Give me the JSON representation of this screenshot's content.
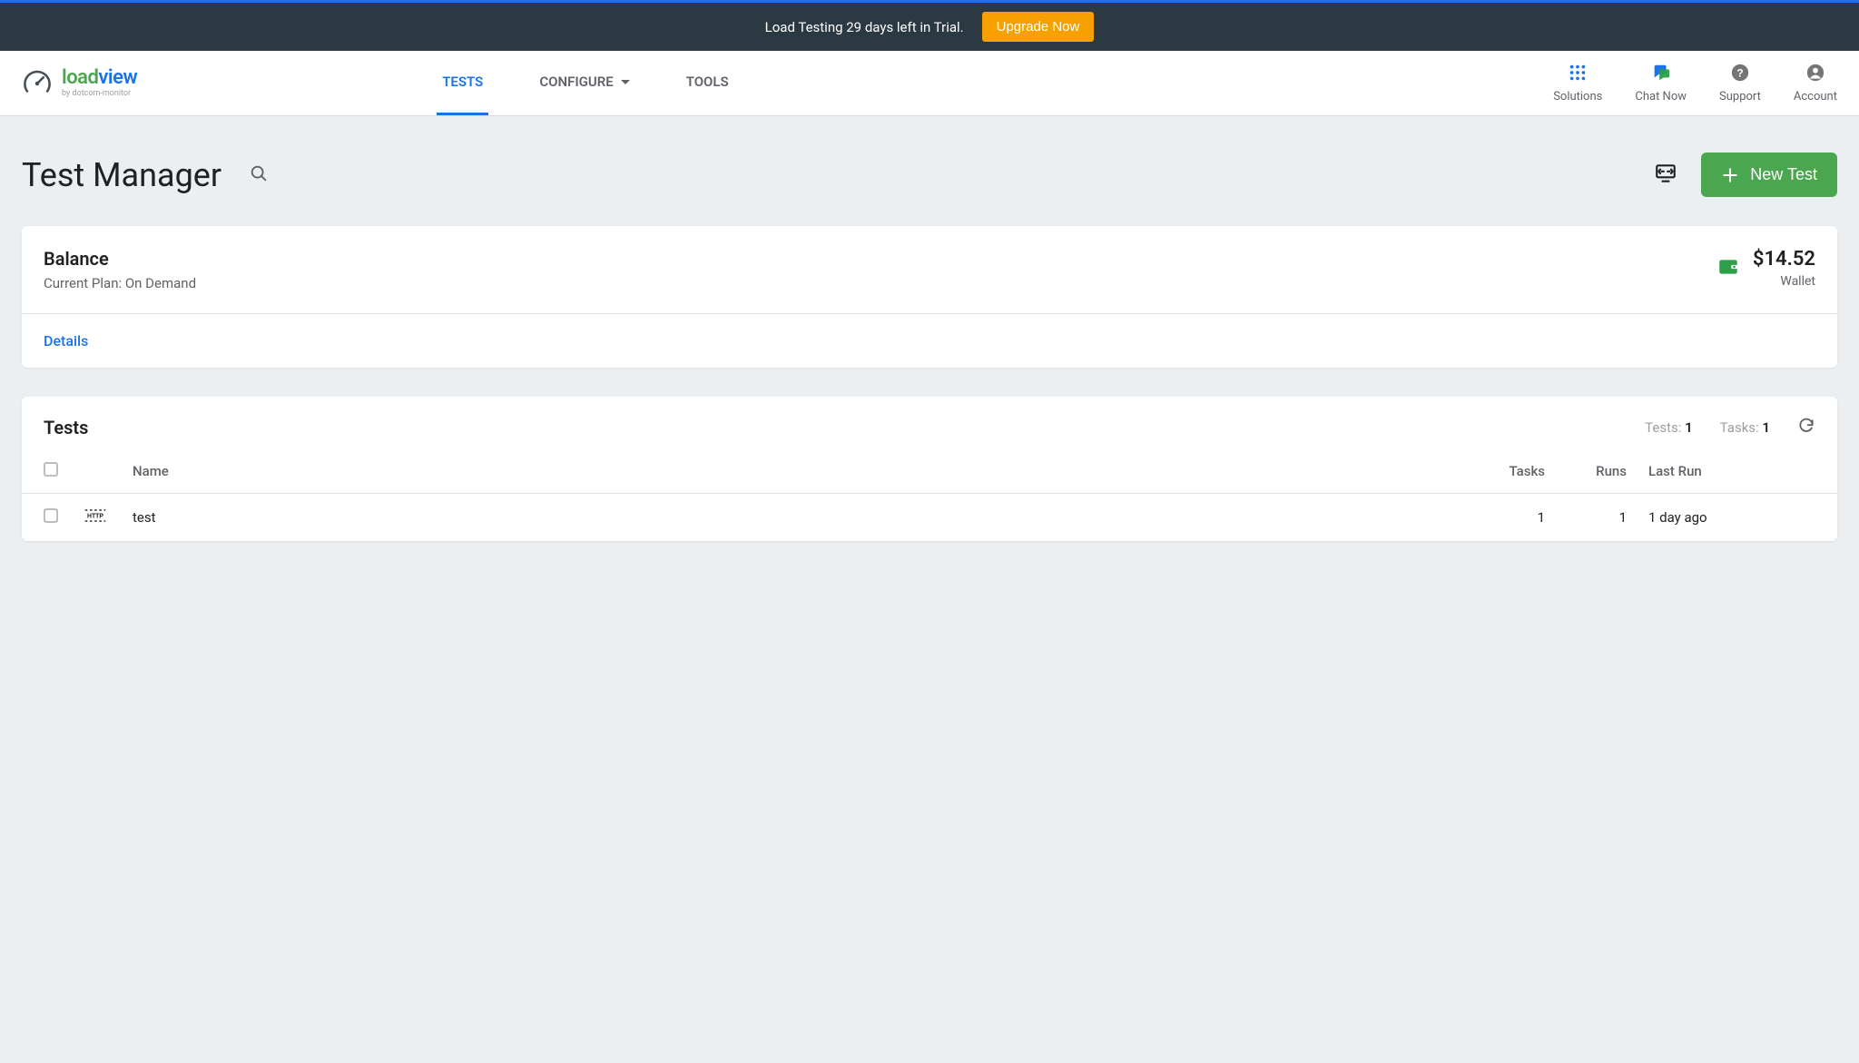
{
  "colors": {
    "accent_blue": "#1a73e8",
    "accent_green": "#4aa64f",
    "accent_orange": "#f6a100",
    "header_dark": "#2b3a42"
  },
  "banner": {
    "text": "Load Testing 29 days left in Trial.",
    "button": "Upgrade Now"
  },
  "logo": {
    "brand_part1": "load",
    "brand_part2": "view",
    "subtitle": "by dotcom-monitor"
  },
  "nav": {
    "tabs": [
      {
        "label": "TESTS",
        "active": true,
        "has_caret": false
      },
      {
        "label": "CONFIGURE",
        "active": false,
        "has_caret": true
      },
      {
        "label": "TOOLS",
        "active": false,
        "has_caret": false
      }
    ]
  },
  "header_actions": [
    {
      "label": "Solutions",
      "icon": "apps"
    },
    {
      "label": "Chat Now",
      "icon": "chat"
    },
    {
      "label": "Support",
      "icon": "help"
    },
    {
      "label": "Account",
      "icon": "account"
    }
  ],
  "page": {
    "title": "Test Manager",
    "new_test_label": "New Test"
  },
  "balance": {
    "title": "Balance",
    "plan_prefix": "Current Plan: ",
    "plan_name": "On Demand",
    "amount": "$14.52",
    "wallet_label": "Wallet",
    "details_label": "Details"
  },
  "tests_panel": {
    "title": "Tests",
    "tests_label": "Tests:",
    "tests_count": "1",
    "tasks_label": "Tasks:",
    "tasks_count": "1",
    "columns": {
      "name": "Name",
      "tasks": "Tasks",
      "runs": "Runs",
      "last_run": "Last Run"
    },
    "rows": [
      {
        "name": "test",
        "tasks": "1",
        "runs": "1",
        "last_run": "1 day ago",
        "type": "http"
      }
    ]
  }
}
